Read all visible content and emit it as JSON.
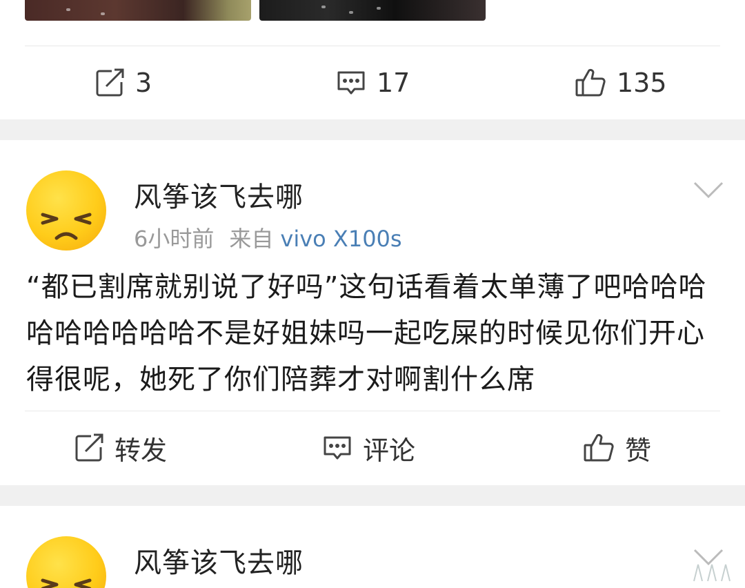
{
  "prev_post": {
    "actions": {
      "repost_count": "3",
      "comment_count": "17",
      "like_count": "135"
    }
  },
  "post": {
    "username": "风筝该飞去哪",
    "time": "6小时前",
    "source_prefix": "来自",
    "device": "vivo X100s",
    "content": "“都已割席就别说了好吗”这句话看着太单薄了吧哈哈哈哈哈哈哈哈哈不是好姐妹吗一起吃屎的时候见你们开心得很呢，她死了你们陪葬才对啊割什么席",
    "actions": {
      "repost_label": "转发",
      "comment_label": "评论",
      "like_label": "赞"
    }
  },
  "next_post": {
    "username": "风筝该飞去哪"
  },
  "icons": {
    "repost": "repost-icon",
    "comment": "comment-icon",
    "like": "thumbs-up-icon",
    "more": "chevron-down-icon"
  },
  "colors": {
    "device_link": "#4a7fb5",
    "band": "#f0f0f0",
    "avatar": "#ffcc1a"
  }
}
